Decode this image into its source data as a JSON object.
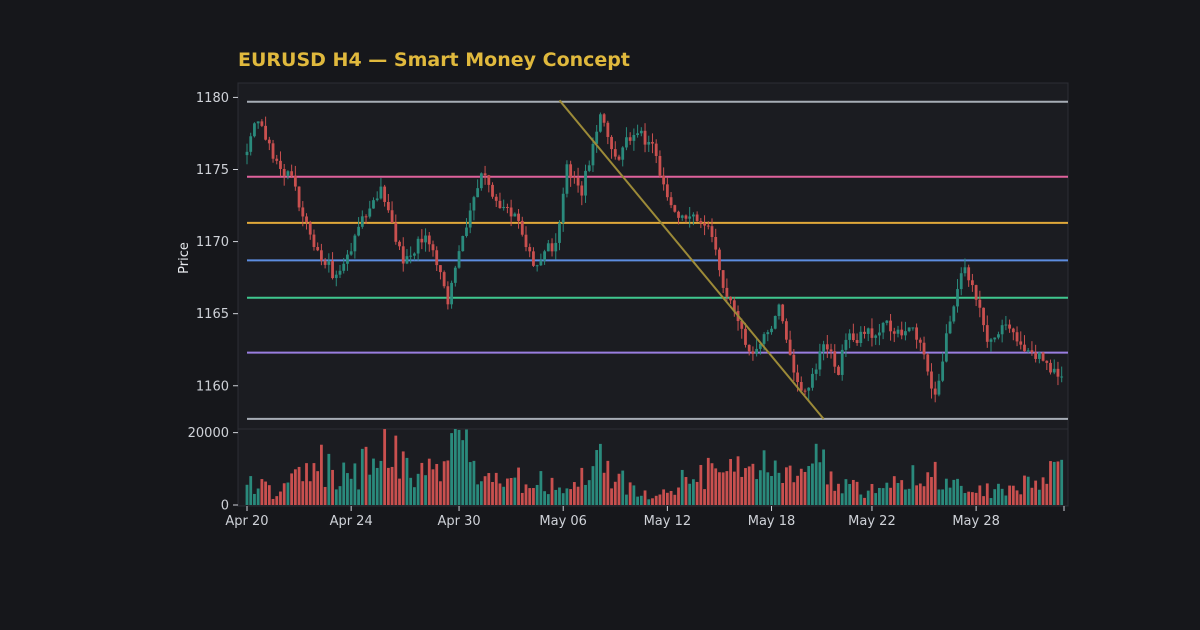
{
  "colors": {
    "background": "#16171b",
    "panel": "#1b1c21",
    "border": "#2c2e35",
    "title": "#e0b93d",
    "up": "#2a8a7c",
    "down": "#c9504f",
    "trendline": "#9c8a38"
  },
  "chart_data": {
    "type": "candlestick",
    "title": "EURUSD H4 — Smart Money Concept",
    "ylabel": "Price",
    "xlabel": "",
    "ylim": [
      1157,
      1181
    ],
    "volume_ylim": [
      0,
      21000
    ],
    "x_tick_labels": [
      "Apr 20",
      "Apr 24",
      "Apr 30",
      "May 06",
      "May 12",
      "May 18",
      "May 22",
      "May 28"
    ],
    "y_ticks": [
      1160,
      1165,
      1170,
      1175,
      1180
    ],
    "volume_ticks": [
      0,
      20000
    ],
    "levels": [
      {
        "value": 1179.7,
        "color": "#a7adb6"
      },
      {
        "value": 1174.5,
        "color": "#e0629c"
      },
      {
        "value": 1171.3,
        "color": "#e0a83a"
      },
      {
        "value": 1168.7,
        "color": "#5d8de0"
      },
      {
        "value": 1166.1,
        "color": "#3fc78f"
      },
      {
        "value": 1162.3,
        "color": "#9a7ee0"
      },
      {
        "value": 1157.7,
        "color": "#a7adb6"
      }
    ],
    "trendline": {
      "from": {
        "index": 84,
        "price": 1179.8
      },
      "to": {
        "index": 155,
        "price": 1157.7
      }
    },
    "anchors": [
      [
        0,
        1176.0
      ],
      [
        4,
        1178.7
      ],
      [
        9,
        1175.5
      ],
      [
        13,
        1174.2
      ],
      [
        18,
        1170.5
      ],
      [
        25,
        1167.3
      ],
      [
        32,
        1171.5
      ],
      [
        37,
        1173.8
      ],
      [
        43,
        1168.5
      ],
      [
        49,
        1170.5
      ],
      [
        55,
        1165.9
      ],
      [
        60,
        1171.2
      ],
      [
        64,
        1174.8
      ],
      [
        69,
        1172.5
      ],
      [
        73,
        1172.0
      ],
      [
        78,
        1168.5
      ],
      [
        84,
        1170.0
      ],
      [
        87,
        1175.0
      ],
      [
        91,
        1173.6
      ],
      [
        96,
        1178.6
      ],
      [
        100,
        1175.5
      ],
      [
        105,
        1177.8
      ],
      [
        110,
        1176.5
      ],
      [
        116,
        1172.0
      ],
      [
        121,
        1171.8
      ],
      [
        125,
        1170.9
      ],
      [
        129,
        1167.2
      ],
      [
        133,
        1164.1
      ],
      [
        137,
        1162.4
      ],
      [
        141,
        1163.8
      ],
      [
        144,
        1165.5
      ],
      [
        148,
        1160.5
      ],
      [
        152,
        1159.6
      ],
      [
        155,
        1162.1
      ],
      [
        157,
        1162.8
      ],
      [
        160,
        1160.6
      ],
      [
        162,
        1163.6
      ],
      [
        166,
        1163.3
      ],
      [
        172,
        1164.2
      ],
      [
        176,
        1163.7
      ],
      [
        180,
        1164.4
      ],
      [
        186,
        1159.2
      ],
      [
        189,
        1163.2
      ],
      [
        194,
        1168.6
      ],
      [
        200,
        1163.2
      ],
      [
        205,
        1164.2
      ],
      [
        210,
        1162.6
      ],
      [
        216,
        1161.6
      ],
      [
        219,
        1160.4
      ]
    ],
    "volume_profile": [
      [
        0,
        9000
      ],
      [
        8,
        3000
      ],
      [
        18,
        15000
      ],
      [
        27,
        9000
      ],
      [
        37,
        18500
      ],
      [
        52,
        9000
      ],
      [
        56,
        20000
      ],
      [
        70,
        9000
      ],
      [
        85,
        7000
      ],
      [
        95,
        15000
      ],
      [
        104,
        6000
      ],
      [
        110,
        3000
      ],
      [
        120,
        11000
      ],
      [
        135,
        11000
      ],
      [
        150,
        16000
      ],
      [
        165,
        5000
      ],
      [
        175,
        7000
      ],
      [
        182,
        14000
      ],
      [
        190,
        6000
      ],
      [
        200,
        5000
      ],
      [
        210,
        7000
      ],
      [
        219,
        13000
      ]
    ],
    "volume_seed": 29
  }
}
